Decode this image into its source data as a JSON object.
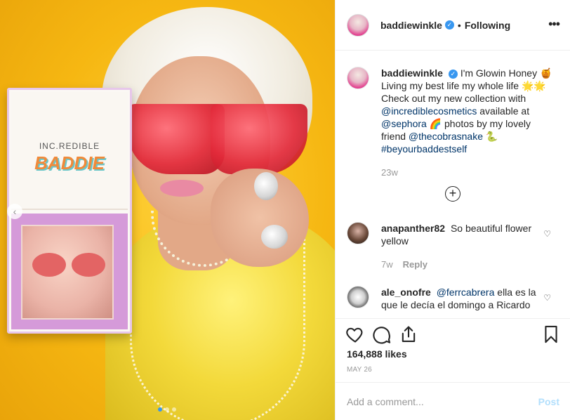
{
  "photo": {
    "palette_brand": "INC.REDIBLE",
    "palette_logo": "BADDIE"
  },
  "header": {
    "username": "baddiewinkle",
    "separator": "•",
    "follow_status": "Following",
    "more_icon": "more-horizontal-icon"
  },
  "caption": {
    "username": "baddiewinkle",
    "line1": "I'm Glowin Honey 🍯",
    "line2": "Living my best life my whole life 🌟🌟",
    "line3": "Check out my new collection with",
    "mention1": "@incrediblecosmetics",
    "line4": " available at",
    "mention2": "@sephora",
    "line5": " 🌈 photos by my lovely",
    "line6": "friend ",
    "mention3": "@thecobrasnake",
    "line6_end": " 🐍",
    "hashtag": "#beyourbaddestself",
    "age": "23w"
  },
  "comments": [
    {
      "username": "anapanther82",
      "text": "So beautiful flower yellow",
      "age": "7w",
      "reply": "Reply"
    },
    {
      "username": "ale_onofre",
      "mention": "@ferrcabrera",
      "text": " ella es la que le decía el domingo a Ricardo"
    }
  ],
  "load_more_icon": "plus-circle-icon",
  "likes": "164,888 likes",
  "date": "MAY 26",
  "add_comment": {
    "placeholder": "Add a comment...",
    "post_label": "Post"
  },
  "colors": {
    "link": "#003569",
    "verified": "#3897f0",
    "post_disabled": "#b2dffc",
    "photo_bg": "#f6b712"
  }
}
